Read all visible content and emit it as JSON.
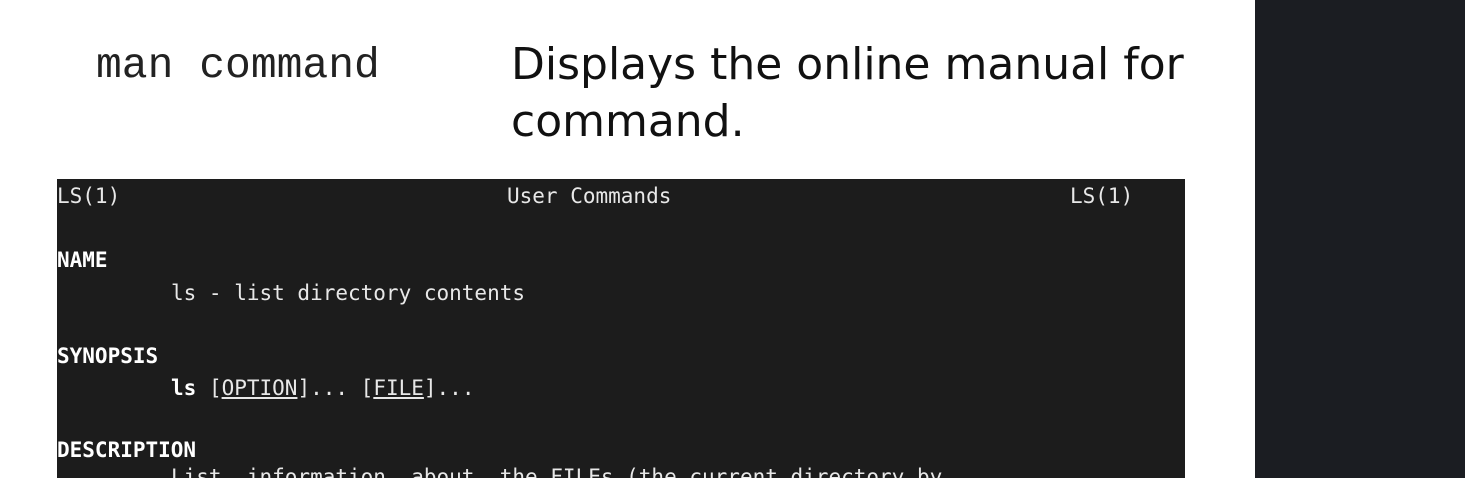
{
  "slide": {
    "command_term": "man command",
    "command_description": "Displays the online manual for command."
  },
  "terminal": {
    "header_left": "LS(1)",
    "header_center": "User Commands",
    "header_right": "LS(1)",
    "sections": [
      {
        "title": "NAME",
        "body": "ls - list directory contents"
      },
      {
        "title": "SYNOPSIS",
        "body_cmd": "ls",
        "body_space": " [",
        "body_arg1": "OPTION",
        "body_mid": "]... [",
        "body_arg2": "FILE",
        "body_end": "]..."
      },
      {
        "title": "DESCRIPTION",
        "body": "List  information  about  the FILEs (the current directory by"
      }
    ]
  },
  "colors": {
    "terminal_bg": "#1c1c1c",
    "side_panel_bg": "#1b1d22"
  }
}
